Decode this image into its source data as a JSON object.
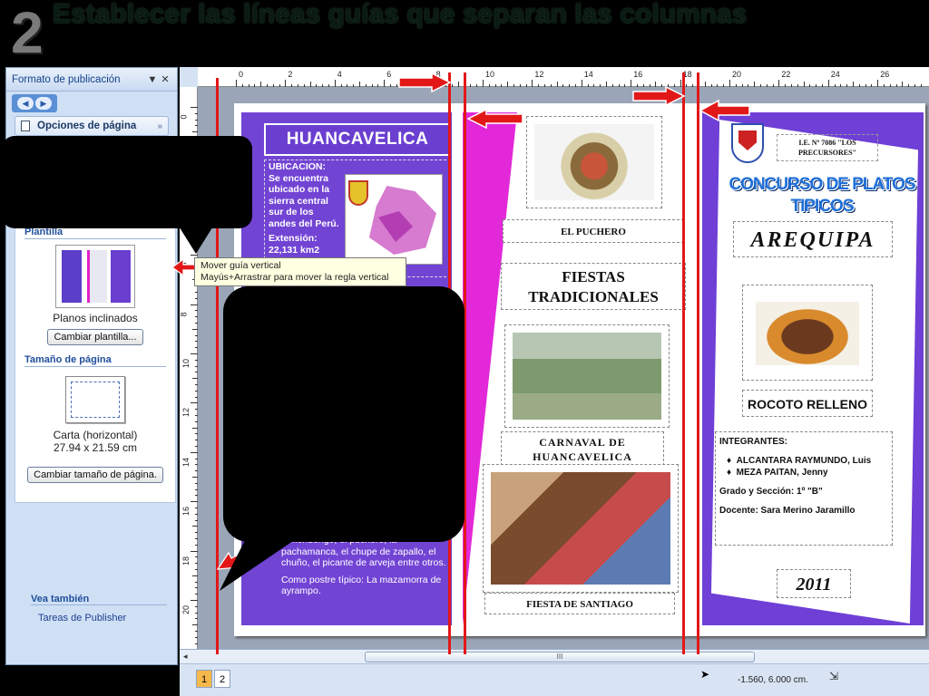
{
  "slide": {
    "step_number": "2",
    "title": "Establecer las líneas guías que separan las columnas"
  },
  "taskpane": {
    "title": "Formato de publicación",
    "menu_glyph": "▼",
    "close_glyph": "✕",
    "options_label": "Opciones de página",
    "template_section": "Plantilla",
    "template_name": "Planos inclinados",
    "change_template": "Cambiar plantilla...",
    "page_size_section": "Tamaño de página",
    "page_size_name": "Carta (horizontal)",
    "page_size_dims": "27.94 x 21.59 cm",
    "change_size": "Cambiar tamaño de página.",
    "see_also": "Vea también",
    "see_also_link": "Tareas de Publisher"
  },
  "rulers": {
    "top_labels": [
      "0",
      "2",
      "4",
      "6",
      "8",
      "10",
      "12",
      "14",
      "16",
      "18",
      "20",
      "22",
      "24",
      "26"
    ],
    "left_labels": [
      "0",
      "2",
      "4",
      "6",
      "8",
      "10",
      "12",
      "14",
      "16",
      "18",
      "20"
    ]
  },
  "tooltip": {
    "line1": "Mover guía vertical",
    "line2": "Mayús+Arrastrar para mover la regla vertical"
  },
  "brochure": {
    "col1_title": "HUANCAVELICA",
    "location_heading": "UBICACION:",
    "location_text": "Se encuentra ubicado en la sierra central sur de los andes del Perú.",
    "extension_heading": "Extensión:",
    "extension_value": "22,131 km2",
    "dishes_text": "...mondongo, el puchero, la pachamanca, el chupe de zapallo, el chuño, el picante de arveja entre otros.",
    "dessert_text": "Como postre típico: La mazamorra de ayrampo.",
    "caption_puchero": "EL PUCHERO",
    "caption_fiestas": "FIESTAS TRADICIONALES",
    "caption_carnaval": "CARNAVAL DE HUANCAVELICA",
    "caption_santiago": "FIESTA DE SANTIAGO",
    "school": "I.E. Nº 7086 \"LOS PRECURSORES\"",
    "contest": "CONCURSO DE PLATOS TIPICOS",
    "region": "AREQUIPA",
    "dish": "ROCOTO RELLENO",
    "members_heading": "INTEGRANTES:",
    "member1": "ALCANTARA RAYMUNDO, Luis",
    "member2": "MEZA PAITAN, Jenny",
    "grade": "Grado y Sección:   1º \"B\"",
    "teacher": "Docente: Sara Merino Jaramillo",
    "year": "2011"
  },
  "status": {
    "page1": "1",
    "page2": "2",
    "coordinates": "-1.560, 6.000 cm.",
    "scroll_grip": "III"
  },
  "colors": {
    "guide": "#e21818",
    "purple": "#7244d4",
    "magenta": "#e228d8"
  }
}
